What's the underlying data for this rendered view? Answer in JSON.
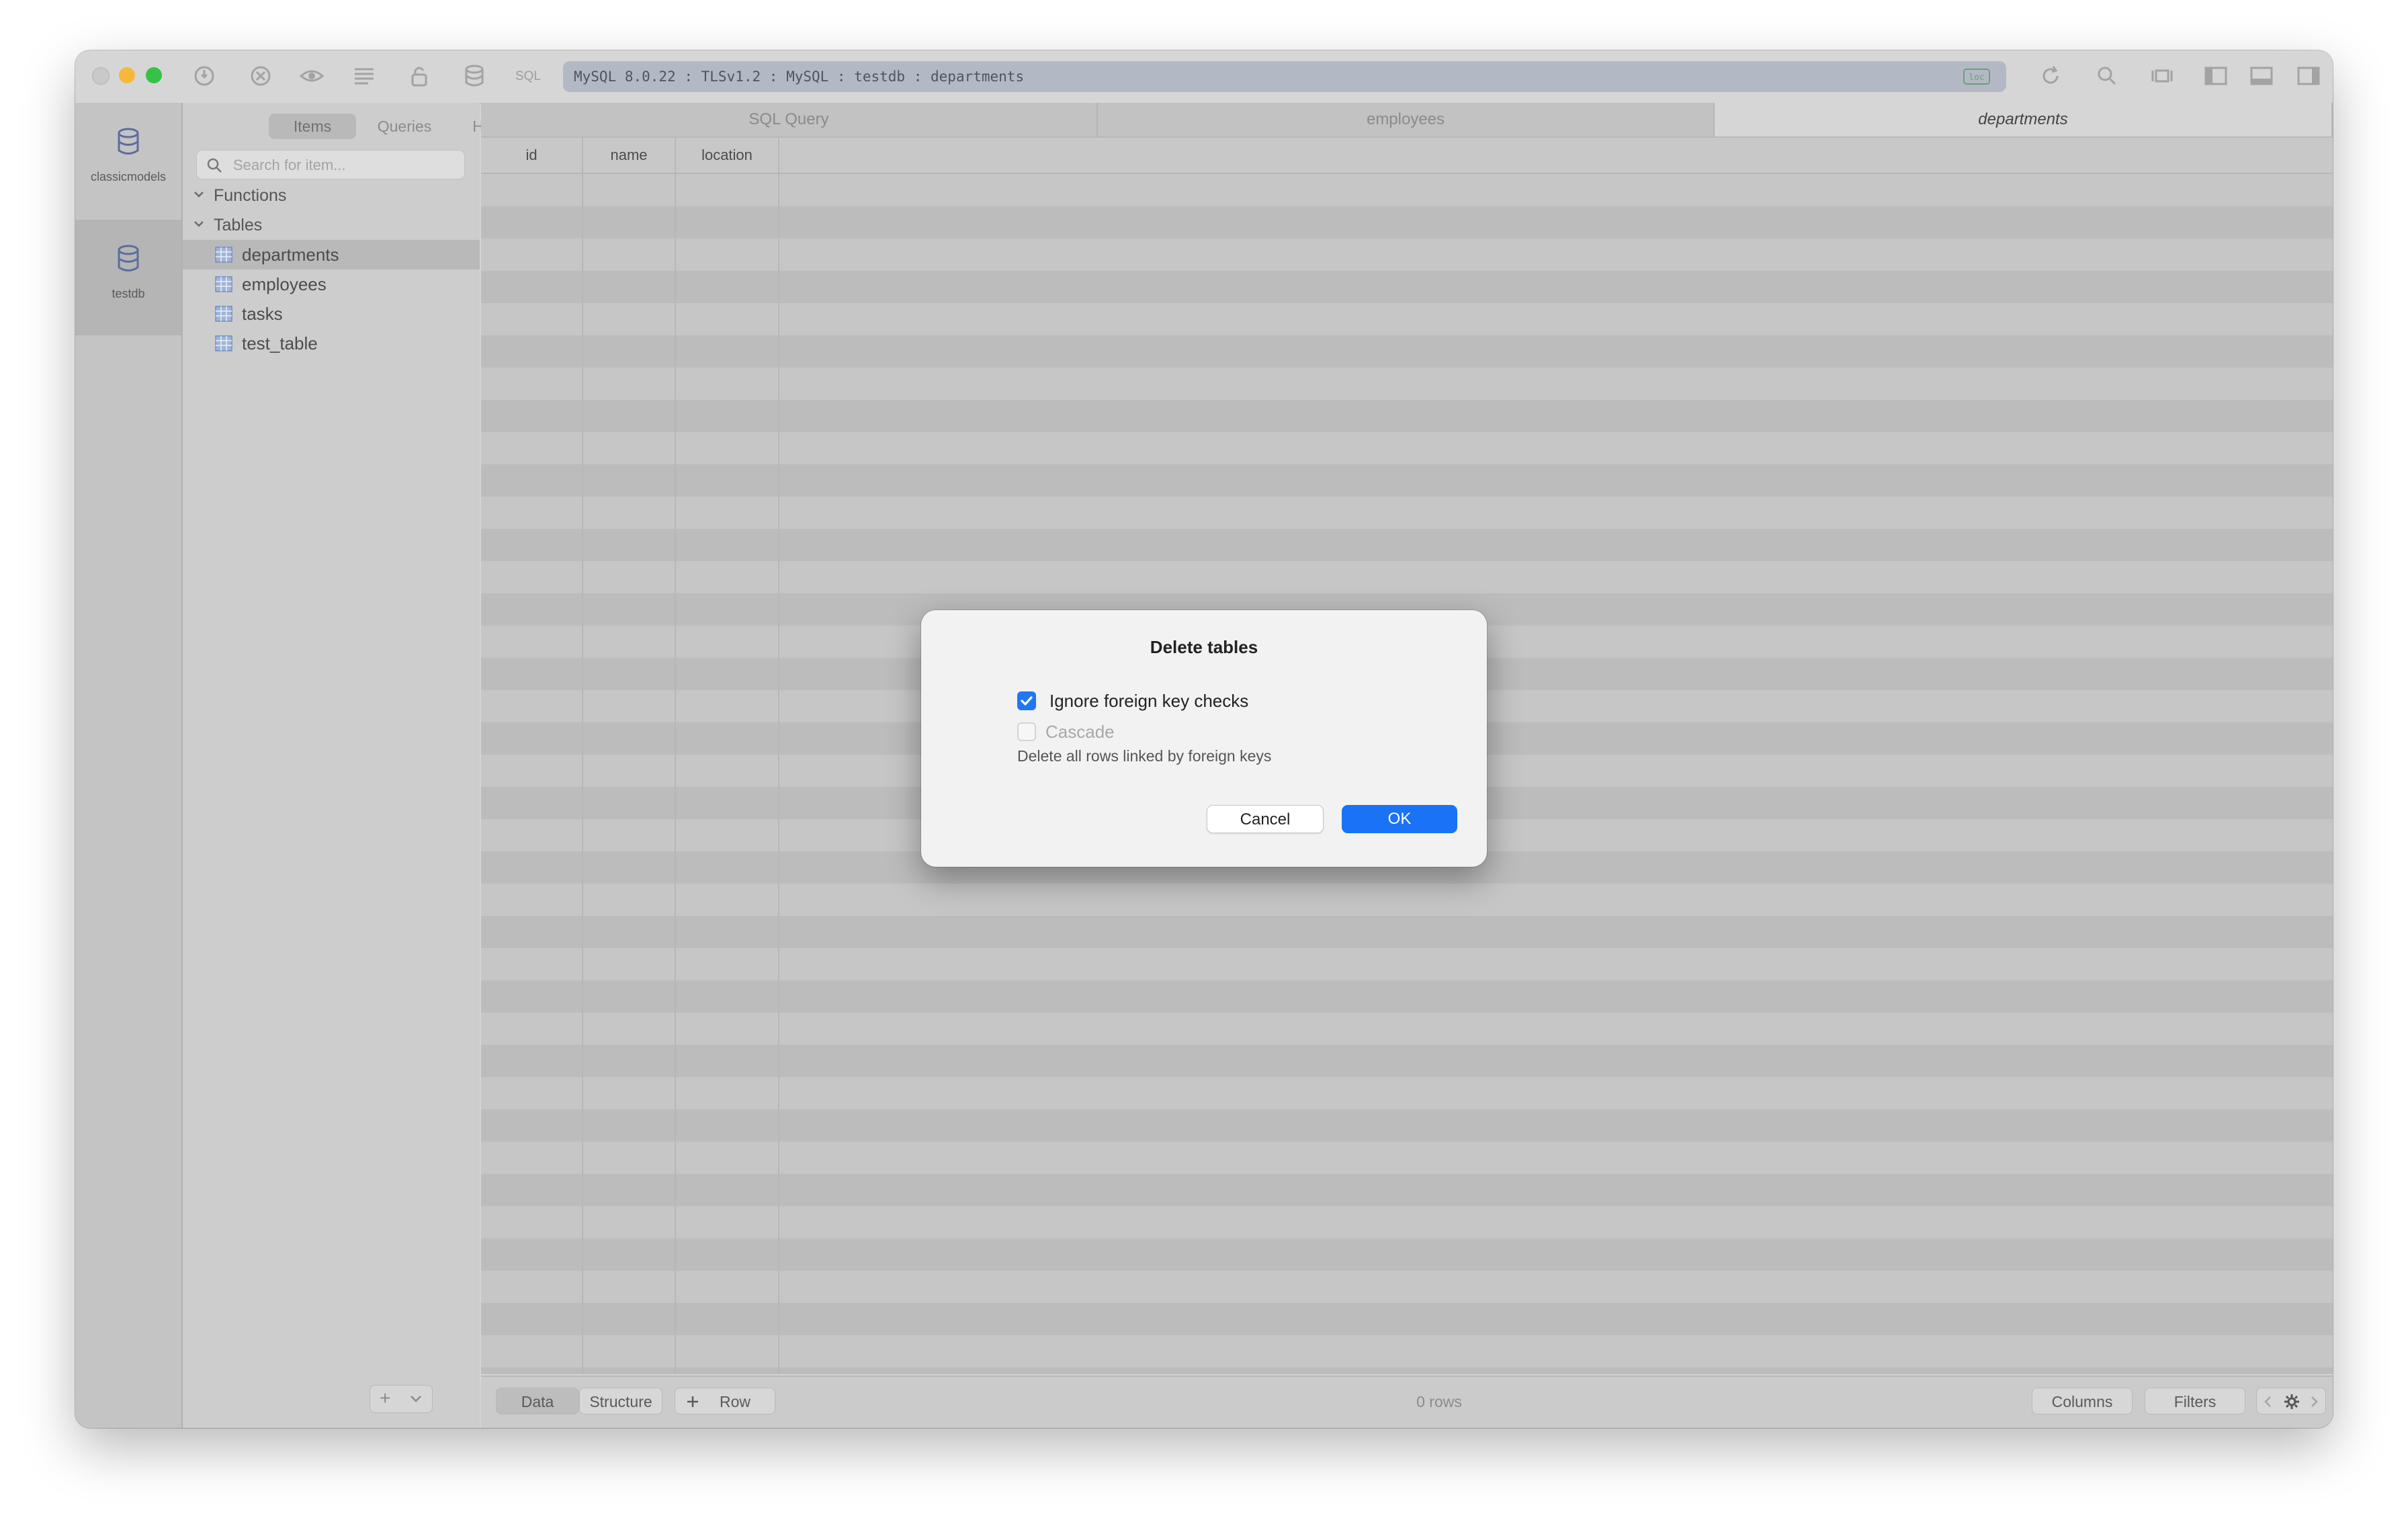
{
  "toolbar": {
    "sql_label": "SQL",
    "connection_info": "MySQL 8.0.22 : TLSv1.2 : MySQL : testdb : departments",
    "badge_label": "loc"
  },
  "rail": {
    "databases": [
      {
        "name": "classicmodels",
        "active": false
      },
      {
        "name": "testdb",
        "active": true
      }
    ]
  },
  "sidebar": {
    "segments": [
      "Items",
      "Queries",
      "History"
    ],
    "active_segment": "Items",
    "search_placeholder": "Search for item...",
    "groups": [
      {
        "label": "Functions",
        "expanded": false
      },
      {
        "label": "Tables",
        "expanded": true
      }
    ],
    "tables": [
      "departments",
      "employees",
      "tasks",
      "test_table"
    ],
    "selected_table": "departments",
    "add_button": "+"
  },
  "tabs": [
    {
      "label": "SQL Query",
      "active": false
    },
    {
      "label": "employees",
      "active": false
    },
    {
      "label": "departments",
      "active": true
    }
  ],
  "grid": {
    "columns": [
      "id",
      "name",
      "location"
    ]
  },
  "bottombar": {
    "data_label": "Data",
    "structure_label": "Structure",
    "add_row_label": "Row",
    "row_count": "0 rows",
    "columns_label": "Columns",
    "filters_label": "Filters"
  },
  "dialog": {
    "title": "Delete tables",
    "option_ignore_fk": {
      "label": "Ignore foreign key checks",
      "checked": true
    },
    "option_cascade": {
      "label": "Cascade",
      "checked": false,
      "disabled": true
    },
    "cascade_description": "Delete all rows linked by foreign keys",
    "cancel_label": "Cancel",
    "ok_label": "OK"
  },
  "colors": {
    "accent": "#1a72f6",
    "traffic_close": "#c9c9c9",
    "traffic_min": "#f6b83a",
    "traffic_max": "#35c246"
  }
}
